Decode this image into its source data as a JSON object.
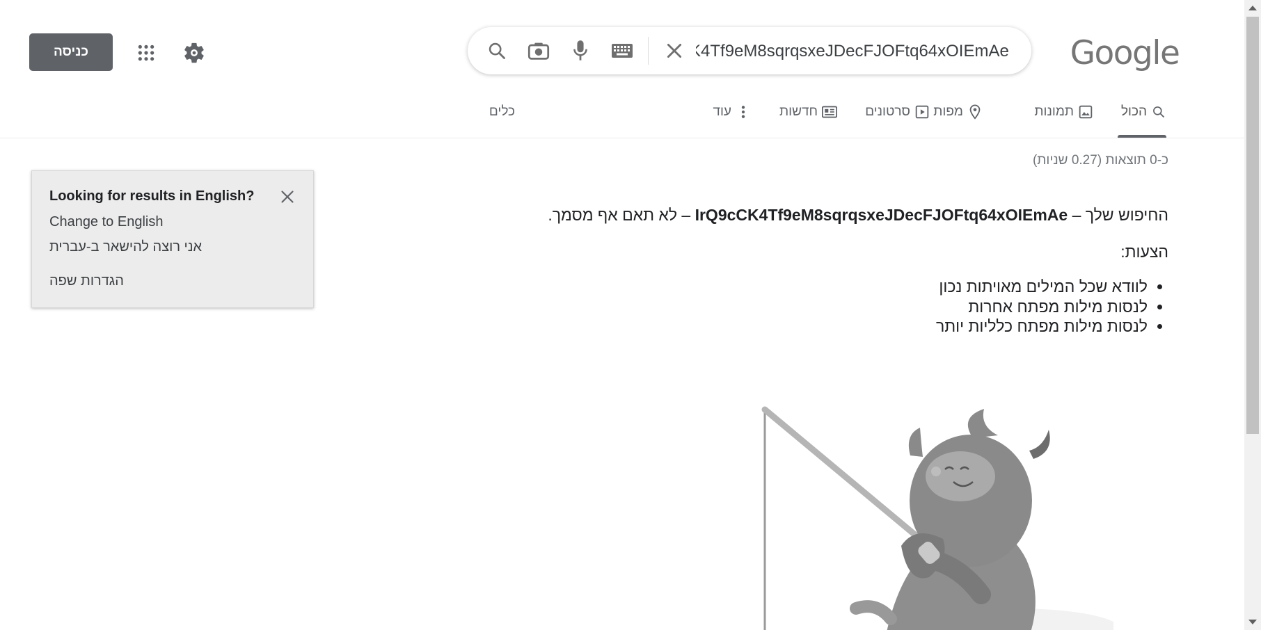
{
  "logo": {
    "text": "Google"
  },
  "search": {
    "query": "IrQ9cCK4Tf9eM8sqrqsxeJDecFJOFtq64xOIEmAe",
    "icons": [
      "search-icon",
      "camera-icon",
      "mic-icon",
      "keyboard-icon",
      "clear-icon"
    ]
  },
  "header": {
    "signin_label": "כניסה",
    "icons": [
      "apps-grid-icon",
      "gear-icon"
    ]
  },
  "tabs": [
    {
      "label": "הכול",
      "icon": "search-icon",
      "active": true
    },
    {
      "label": "תמונות",
      "icon": "image-icon"
    },
    {
      "label": "מפות",
      "icon": "map-pin-icon"
    },
    {
      "label": "סרטונים",
      "icon": "video-icon"
    },
    {
      "label": "חדשות",
      "icon": "news-icon"
    },
    {
      "label": "עוד",
      "icon": "more-vert-icon"
    },
    {
      "label": "כלים"
    }
  ],
  "results": {
    "stats": "כ-0 תוצאות (0.27 שניות)",
    "message_prefix": "החיפוש שלך –",
    "message_query": "IrQ9cCK4Tf9eM8sqrqsxeJDecFJOFtq64xOIEmAe",
    "message_suffix": "– לא תאם אף מסמך.",
    "suggestions_title": "הצעות:",
    "suggestions": [
      "לוודא שכל המילים מאויתות נכון",
      "לנסות מילות מפתח אחרות",
      "לנסות מילות מפתח כלליות יותר"
    ]
  },
  "language_popup": {
    "title": "Looking for results in English?",
    "change_label": "Change to English",
    "stay_label": "אני רוצה להישאר ב-עברית",
    "settings_label": "הגדרות שפה"
  },
  "colors": {
    "signin_bg": "#5f6368",
    "popup_bg": "#ececec",
    "tab_active_underline": "#5f6368"
  }
}
